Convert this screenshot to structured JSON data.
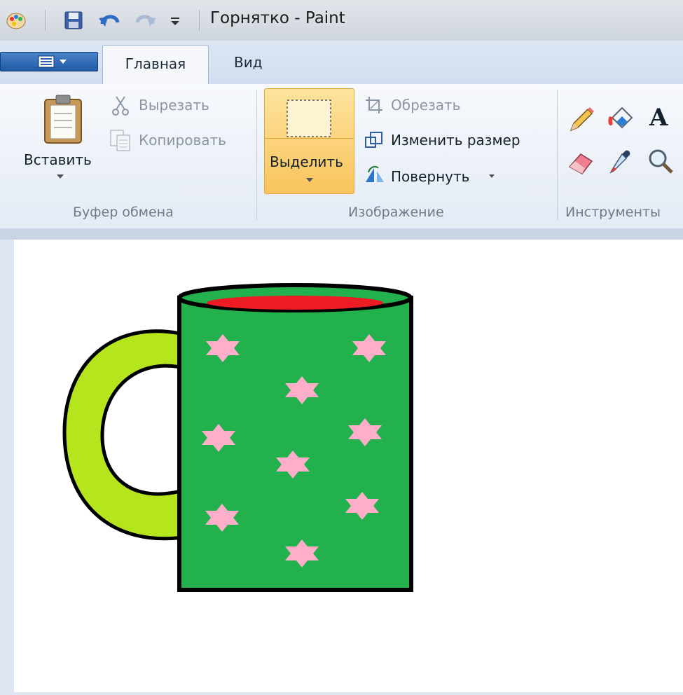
{
  "window": {
    "title": "Горнятко - Paint"
  },
  "tabs": {
    "home": "Главная",
    "view": "Вид"
  },
  "clipboard": {
    "paste": "Вставить",
    "cut": "Вырезать",
    "copy": "Копировать",
    "group": "Буфер обмена"
  },
  "image": {
    "select": "Выделить",
    "crop": "Обрезать",
    "resize": "Изменить размер",
    "rotate": "Повернуть",
    "group": "Изображение"
  },
  "tools": {
    "group": "Инструменты",
    "text_tool": "A",
    "items": [
      "pencil-icon",
      "fill-icon",
      "text-icon",
      "eraser-icon",
      "color-picker-icon",
      "magnifier-icon"
    ]
  },
  "colors": {
    "mug_body": "#22b14c",
    "mug_rim_inside": "#ed1c24",
    "mug_handle": "#b5e61d",
    "stars": "#ffaec9",
    "outline": "#000000"
  }
}
